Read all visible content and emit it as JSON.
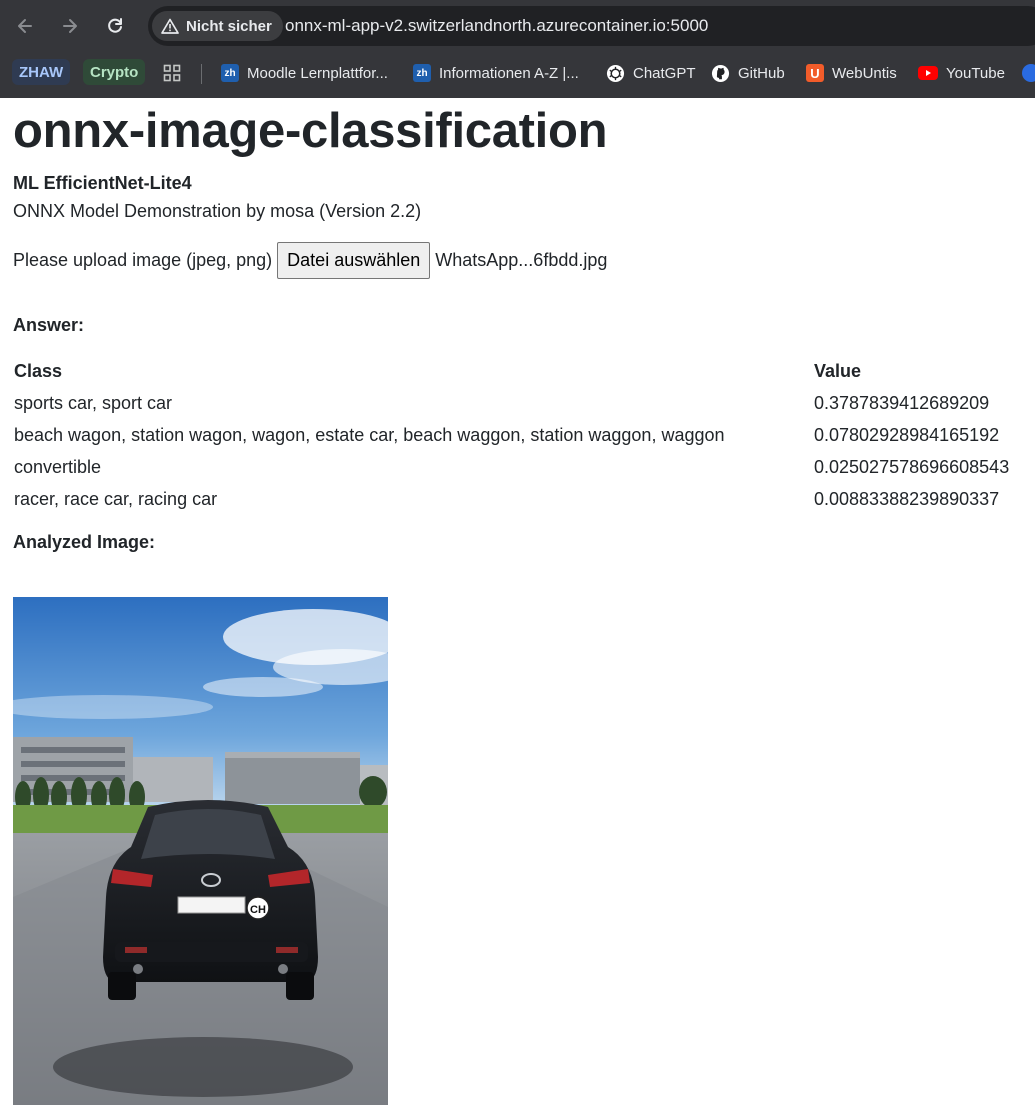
{
  "browser": {
    "security_label": "Nicht sicher",
    "url": "onnx-ml-app-v2.switzerlandnorth.azurecontainer.io:5000",
    "bookmarks": {
      "zhaw": "ZHAW",
      "crypto": "Crypto",
      "moodle": "Moodle Lernplattfor...",
      "info": "Informationen A-Z |...",
      "chatgpt": "ChatGPT",
      "github": "GitHub",
      "webuntis": "WebUntis",
      "youtube": "YouTube"
    },
    "colors": {
      "chrome_bg": "#35363a",
      "omnibox_bg": "#202124",
      "zhaw_chip": "#2f3b52",
      "crypto_chip": "#2f4a38"
    }
  },
  "page": {
    "title": "onnx-image-classification",
    "model": "ML EfficientNet-Lite4",
    "subtitle": "ONNX Model Demonstration by mosa (Version 2.2)",
    "upload_label": "Please upload image (jpeg, png)",
    "file_button": "Datei auswählen",
    "file_name": "WhatsApp...6fbdd.jpg",
    "answer_label": "Answer:",
    "table": {
      "headers": {
        "class": "Class",
        "value": "Value"
      },
      "rows": [
        {
          "class": "sports car, sport car",
          "value": "0.3787839412689209"
        },
        {
          "class": "beach wagon, station wagon, wagon, estate car, beach waggon, station waggon, waggon",
          "value": "0.07802928984165192"
        },
        {
          "class": "convertible",
          "value": "0.025027578696608543"
        },
        {
          "class": "racer, race car, racing car",
          "value": "0.00883388239890337"
        }
      ]
    },
    "analyzed_label": "Analyzed Image:",
    "plate_country": "CH"
  }
}
